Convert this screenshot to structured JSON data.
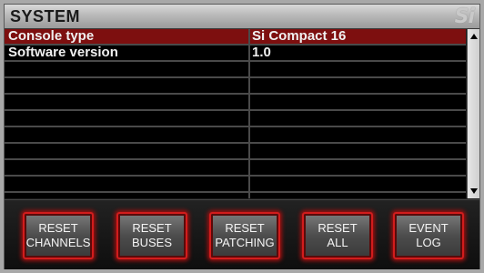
{
  "window": {
    "title": "SYSTEM",
    "logo": "Si"
  },
  "table": {
    "rows": [
      {
        "label": "Console type",
        "value": "Si Compact 16",
        "selected": true
      },
      {
        "label": "Software version",
        "value": "1.0",
        "selected": false
      },
      {
        "label": "",
        "value": "",
        "selected": false
      },
      {
        "label": "",
        "value": "",
        "selected": false
      },
      {
        "label": "",
        "value": "",
        "selected": false
      },
      {
        "label": "",
        "value": "",
        "selected": false
      },
      {
        "label": "",
        "value": "",
        "selected": false
      },
      {
        "label": "",
        "value": "",
        "selected": false
      },
      {
        "label": "",
        "value": "",
        "selected": false
      },
      {
        "label": "",
        "value": "",
        "selected": false
      }
    ]
  },
  "buttons": [
    {
      "line1": "RESET",
      "line2": "CHANNELS"
    },
    {
      "line1": "RESET",
      "line2": "BUSES"
    },
    {
      "line1": "RESET",
      "line2": "PATCHING"
    },
    {
      "line1": "RESET",
      "line2": "ALL"
    },
    {
      "line1": "EVENT",
      "line2": "LOG"
    }
  ],
  "colors": {
    "selected_row": "#7d0f0f",
    "button_glow": "#d21c1c"
  }
}
